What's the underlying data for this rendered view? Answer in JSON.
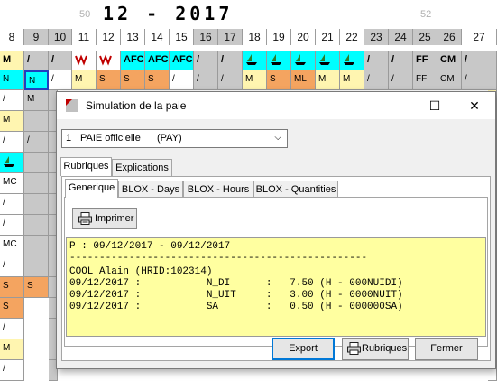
{
  "header": {
    "title": "12 - 2017",
    "week_left": "50",
    "week_right": "52"
  },
  "date_row": [
    "8",
    "9",
    "10",
    "11",
    "12",
    "13",
    "14",
    "15",
    "16",
    "17",
    "18",
    "19",
    "20",
    "21",
    "22",
    "23",
    "24",
    "25",
    "26",
    "27"
  ],
  "grid_visible_codes": {
    "row1": [
      "M",
      "/",
      "/",
      "",
      "",
      "AFC",
      "AFC",
      "AFC",
      "/",
      "/",
      "",
      "",
      "",
      "",
      "",
      "/",
      "/",
      "FF",
      "CM",
      "/"
    ],
    "row2": [
      "N",
      "N",
      "/",
      "M",
      "S",
      "S",
      "S",
      "/",
      "/",
      "/",
      "M",
      "S",
      "ML",
      "M",
      "M",
      "/",
      "/",
      "FF",
      "CM",
      "/"
    ],
    "left_column": [
      "/",
      "M",
      "/",
      "",
      "MC",
      "/",
      "/",
      "MC",
      "/",
      "S",
      "S",
      "/",
      "M",
      "/"
    ],
    "left_column_2": [
      "M",
      "",
      "/",
      "",
      "",
      "",
      "",
      "",
      "",
      "S"
    ]
  },
  "dialog": {
    "title": "Simulation de la paie",
    "controls": {
      "minimize": "—",
      "maximize": "☐",
      "close": "✕"
    },
    "payroll_select": {
      "number": "1",
      "label": "PAIE officielle",
      "code": "(PAY)"
    },
    "outer_tabs": [
      "Rubriques",
      "Explications"
    ],
    "inner_tabs": [
      "Generique",
      "BLOX - Days",
      "BLOX - Hours",
      "BLOX - Quantities"
    ],
    "print_button": "Imprimer",
    "report_lines": [
      "P : 09/12/2017 - 09/12/2017",
      "--------------------------------------------------",
      "COOL Alain (HRID:102314)",
      "09/12/2017 :           N_DI      :   7.50 (H - 000NUIDI)",
      "09/12/2017 :           N_UIT     :   3.00 (H - 0000NUIT)",
      "09/12/2017 :           SA        :   0.50 (H - 000000SA)"
    ],
    "footer_buttons": {
      "export": "Export",
      "rubriques": "Rubriques",
      "close": "Fermer"
    }
  },
  "colors": {
    "cyan": "#00ffff",
    "orange": "#f4a460",
    "yellow_report": "#ffffa0",
    "weekend_gray": "#c8c8c8",
    "accent_blue": "#0078d7"
  }
}
